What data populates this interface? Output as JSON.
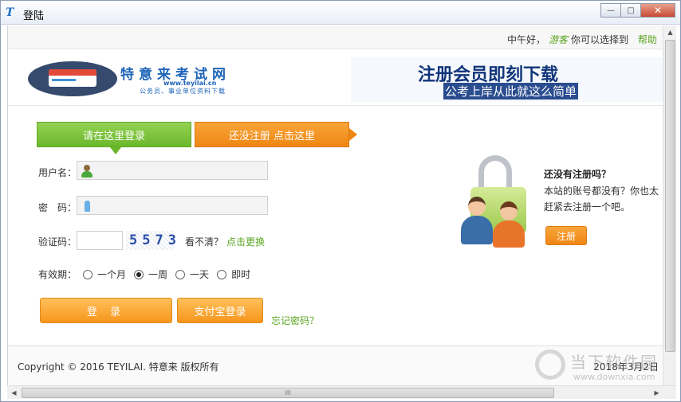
{
  "window": {
    "title": "登陆",
    "app_icon": "T",
    "minimize": "—",
    "maximize": "□",
    "close": "✕"
  },
  "topbar": {
    "greeting_prefix": "中午好，",
    "guest_name": "游客",
    "greeting_suffix": "你可以选择到",
    "help": "帮助"
  },
  "logo": {
    "title": "特意来考试网",
    "url": "www.teyilai.cn",
    "subtitle": "公务员、事业单位资料下载"
  },
  "ad_banner": {
    "main": "注册会员即刻下载",
    "sub": "公考上岸从此就这么简单"
  },
  "tabs": {
    "login": "请在这里登录",
    "register": "还没注册 点击这里"
  },
  "form": {
    "username_label": "用户名：",
    "username_value": "",
    "password_label": "密　码：",
    "password_value": "",
    "captcha_label": "验证码：",
    "captcha_value": "",
    "captcha_code": "5573",
    "captcha_hint": "看不清？",
    "captcha_refresh": "点击更换",
    "validity_label": "有效期：",
    "validity_options": [
      "一个月",
      "一周",
      "一天",
      "即时"
    ],
    "validity_selected": "一周",
    "login_button": "登 录",
    "alipay_button": "支付宝登录",
    "forgot_password": "忘记密码？"
  },
  "side_panel": {
    "title": "还没有注册吗？",
    "text_line1": "本站的账号都没有？你也太",
    "text_line2": "赶紧去注册一个吧。",
    "register_button": "注册"
  },
  "footer": {
    "copyright": "Copyright © 2016 TEYILAI. 特意来 版权所有",
    "date": "2018年3月2日"
  },
  "scroll": {
    "up_arrow": "▲",
    "left_arrow": "◀",
    "right_arrow": "▶",
    "grip": "III"
  },
  "watermark": {
    "text": "当下软件园",
    "url": "www.downxia.com"
  },
  "colors": {
    "accent_green": "#6bb82c",
    "accent_orange": "#ee8613",
    "link_green": "#5aa520",
    "banner_blue": "#10357a"
  },
  "icons": {
    "user": "user-icon",
    "password": "key-icon",
    "lock": "lock-icon"
  }
}
